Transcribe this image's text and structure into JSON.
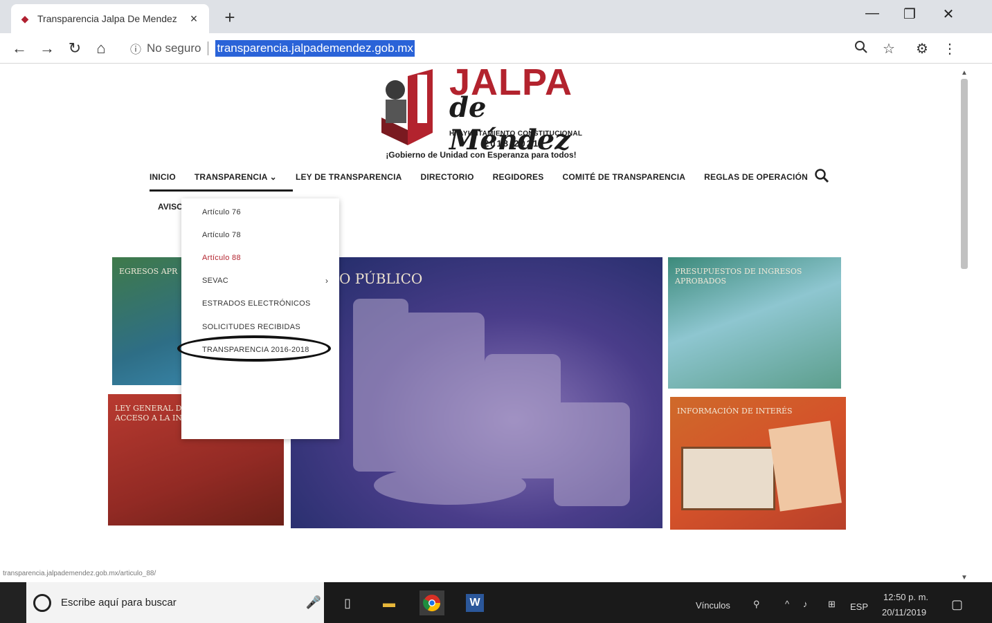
{
  "browser": {
    "tab_title": "Transparencia Jalpa De Mendez",
    "tab_close": "×",
    "new_tab": "+",
    "security_label": "No seguro",
    "url": "transparencia.jalpademendez.gob.mx",
    "status_url": "transparencia.jalpademendez.gob.mx/articulo_88/"
  },
  "header": {
    "logo_jalpa": "JALPA",
    "logo_de": "de Méndez",
    "logo_ayto": "H. AYUNTAMIENTO CONSTITUCIONAL",
    "logo_years": "2018-2021",
    "slogan": "¡Gobierno de Unidad con Esperanza para todos!"
  },
  "nav": {
    "items": [
      "INICIO",
      "TRANSPARENCIA ⌄",
      "LEY DE TRANSPARENCIA",
      "DIRECTORIO",
      "REGIDORES",
      "COMITÉ DE TRANSPARENCIA",
      "REGLAS DE OPERACIÓN"
    ],
    "aviso": "AVISO"
  },
  "dropdown": {
    "items": [
      "Artículo 76",
      "Artículo 78",
      "Artículo 88",
      "SEVAC",
      "ESTRADOS ELECTRÓNICOS",
      "SOLICITUDES RECIBIDAS",
      "TRANSPARENCIA 2016-2018"
    ],
    "submenu_arrow": "›"
  },
  "tiles": {
    "egresos": "EGRESOS APR",
    "main": "O PÚBLICO",
    "presupuestos": "PRESUPUESTOS DE INGRESOS APROBADOS",
    "ley_general": "LEY GENERAL DE TRANSPARENCIA Y ACCESO A LA INFORMACIÓN PÚBLICA",
    "informacion": "INFORMACIÓN DE INTERÉS"
  },
  "taskbar": {
    "search_placeholder": "Escribe aquí para buscar",
    "vinculos": "Vínculos",
    "lang": "ESP",
    "time": "12:50 p. m.",
    "date": "20/11/2019"
  },
  "colors": {
    "brand_red": "#b3232e",
    "url_highlight": "#2a63d8",
    "taskbar": "#1a1a1a"
  }
}
